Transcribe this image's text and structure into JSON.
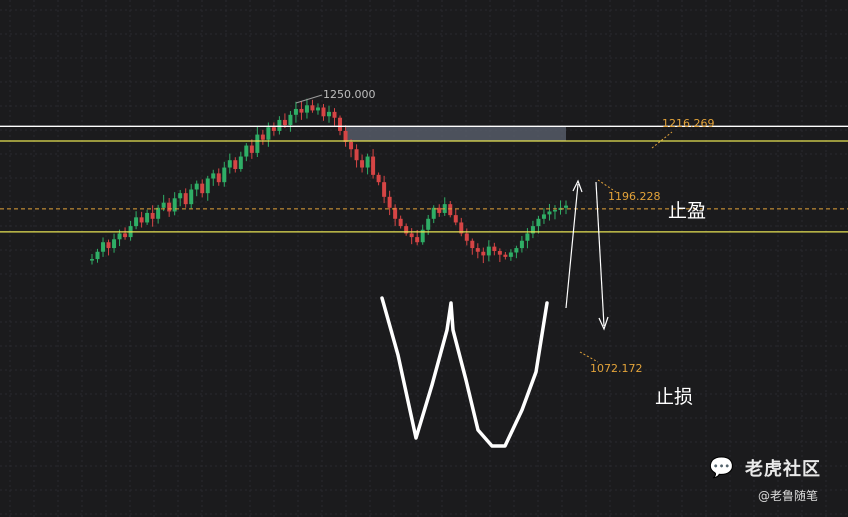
{
  "chart_data": {
    "type": "candlestick",
    "title": "",
    "ylim": [
      1000,
      1270
    ],
    "grid": true,
    "annotations": {
      "peak_label": "1250.000",
      "upper_line_label": "1216.269",
      "take_profit_line_label": "1196.228",
      "stop_loss_line_label": "1072.172",
      "take_profit_text": "止盈",
      "stop_loss_text": "止损",
      "pattern": "W"
    },
    "levels": {
      "peak": 1250.0,
      "upper": 1216.269,
      "take_profit": 1196.228,
      "mid_dashed": 1103.5,
      "stop_loss": 1072.172
    },
    "series": [
      {
        "values": [
          1035,
          1045,
          1058,
          1050,
          1062,
          1070,
          1065,
          1080,
          1092,
          1085,
          1098,
          1090,
          1105,
          1112,
          1100,
          1118,
          1125,
          1110,
          1130,
          1138,
          1125,
          1145,
          1152,
          1140,
          1160,
          1170,
          1158,
          1175,
          1190,
          1180,
          1205,
          1198,
          1215,
          1210,
          1225,
          1218,
          1232,
          1240,
          1235,
          1245,
          1238,
          1242,
          1230,
          1236,
          1228,
          1210,
          1195,
          1185,
          1170,
          1160,
          1175,
          1150,
          1140,
          1120,
          1105,
          1090,
          1080,
          1070,
          1065,
          1058,
          1075,
          1090,
          1105,
          1098,
          1110,
          1095,
          1085,
          1070,
          1060,
          1050,
          1045,
          1040,
          1052,
          1046,
          1041,
          1038,
          1044,
          1050,
          1060,
          1070,
          1080,
          1090,
          1096,
          1100,
          1102,
          1105,
          1108
        ]
      }
    ]
  },
  "watermark": {
    "brand": "老虎社区",
    "author": "@老鲁随笔"
  },
  "colors": {
    "up": "#2fae66",
    "down": "#d64545",
    "white_line": "#ffffff",
    "yellow_line": "#e6e253",
    "orange_dashed": "#e3a33a",
    "grid": "#2a2a2e",
    "zone": "#5d6472"
  }
}
